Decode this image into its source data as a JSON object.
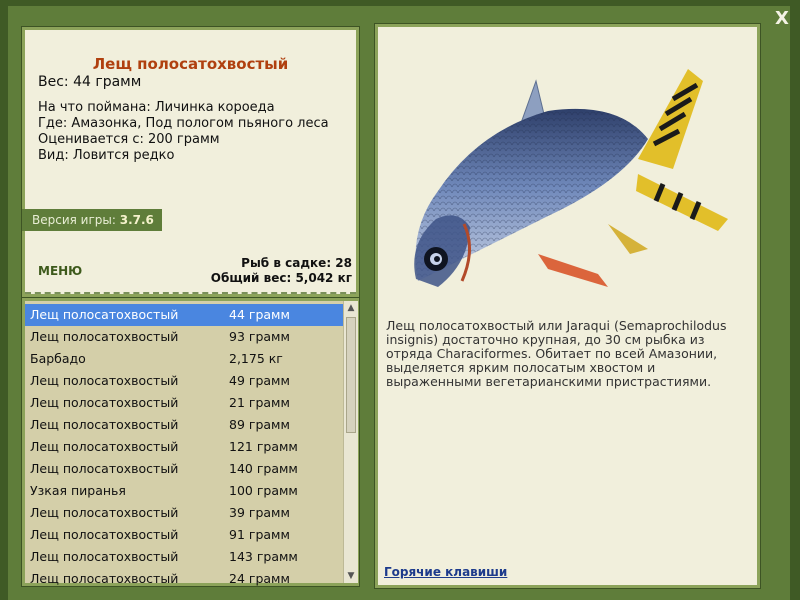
{
  "fish": {
    "title": "Лещ полосатохвостый",
    "weight": "Вес: 44 грамм",
    "caught_on": "На что поймана: Личинка короеда",
    "location": "Где: Амазонка, Под пологом пьяного леса",
    "valued_from": "Оценивается с: 200 грамм",
    "kind": "Вид: Ловится редко",
    "description": "Лещ полосатохвостый или Jaraqui (Semaprochilodus insignis) достаточно крупная, до 30 см рыбка из отряда Characiformes. Обитает по всей Амазонии, выделяется ярким полосатым хвостом и выраженными вегетарианскими пристрастиями."
  },
  "version": {
    "label": "Версия игры:",
    "value": "3.7.6"
  },
  "menu_label": "МЕНЮ",
  "cage": {
    "count": "Рыб в садке: 28",
    "total_weight": "Общий вес: 5,042 кг"
  },
  "catch_list": [
    {
      "name": "Лещ полосатохвостый",
      "weight": "44 грамм"
    },
    {
      "name": "Лещ полосатохвостый",
      "weight": "93 грамм"
    },
    {
      "name": "Барбадо",
      "weight": "2,175 кг"
    },
    {
      "name": "Лещ полосатохвостый",
      "weight": "49 грамм"
    },
    {
      "name": "Лещ полосатохвостый",
      "weight": "21 грамм"
    },
    {
      "name": "Лещ полосатохвостый",
      "weight": "89 грамм"
    },
    {
      "name": "Лещ полосатохвостый",
      "weight": "121 грамм"
    },
    {
      "name": "Лещ полосатохвостый",
      "weight": "140 грамм"
    },
    {
      "name": "Узкая пиранья",
      "weight": "100 грамм"
    },
    {
      "name": "Лещ полосатохвостый",
      "weight": "39 грамм"
    },
    {
      "name": "Лещ полосатохвостый",
      "weight": "91 грамм"
    },
    {
      "name": "Лещ полосатохвостый",
      "weight": "143 грамм"
    },
    {
      "name": "Лещ полосатохвостый",
      "weight": "24 грамм"
    }
  ],
  "hotkeys_label": "Горячие клавиши",
  "close_label": "X",
  "icons": {
    "close": "close-icon",
    "scroll_up": "triangle-up",
    "scroll_down": "triangle-down"
  },
  "colors": {
    "frame": "#5f7d3a",
    "panel": "#f1efdc",
    "title": "#b0400f",
    "selected_row": "#4a86e0"
  }
}
